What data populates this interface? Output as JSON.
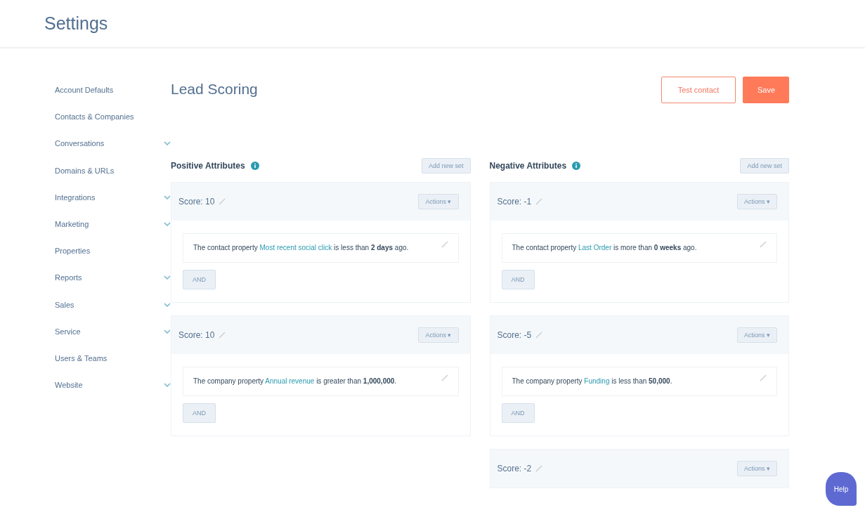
{
  "page_title": "Settings",
  "sidebar": {
    "items": [
      {
        "label": "Account Defaults",
        "expandable": false
      },
      {
        "label": "Contacts & Companies",
        "expandable": false
      },
      {
        "label": "Conversations",
        "expandable": true
      },
      {
        "label": "Domains & URLs",
        "expandable": false
      },
      {
        "label": "Integrations",
        "expandable": true
      },
      {
        "label": "Marketing",
        "expandable": true
      },
      {
        "label": "Properties",
        "expandable": false
      },
      {
        "label": "Reports",
        "expandable": true
      },
      {
        "label": "Sales",
        "expandable": true
      },
      {
        "label": "Service",
        "expandable": true
      },
      {
        "label": "Users & Teams",
        "expandable": false
      },
      {
        "label": "Website",
        "expandable": true
      }
    ]
  },
  "heading": "Lead Scoring",
  "buttons": [
    {
      "label": "Test contact",
      "kind": "secondary"
    },
    {
      "label": "Save",
      "kind": "primary"
    }
  ],
  "columns": [
    {
      "title": "Positive Attributes",
      "add_button": "Add new set",
      "sets": [
        {
          "score": "Score: 10",
          "actions": "Actions ▾",
          "rules": [
            {
              "prefix": "The contact property",
              "property": "Most recent social click",
              "suffix": "is less than **2 days** ago."
            }
          ],
          "and_button": "AND"
        },
        {
          "score": "Score: 10",
          "actions": "Actions ▾",
          "rules": [
            {
              "prefix": "The company property",
              "property": "Annual revenue",
              "suffix": "is greater than **1,000,000**."
            }
          ],
          "and_button": "AND"
        }
      ]
    },
    {
      "title": "Negative Attributes",
      "add_button": "Add new set",
      "sets": [
        {
          "score": "Score: -1",
          "actions": "Actions ▾",
          "rules": [
            {
              "prefix": "The contact property",
              "property": "Last Order",
              "suffix": "is more than **0 weeks** ago."
            }
          ],
          "and_button": "AND"
        },
        {
          "score": "Score: -5",
          "actions": "Actions ▾",
          "rules": [
            {
              "prefix": "The company property",
              "property": "Funding",
              "suffix": "is less than **50,000**."
            }
          ],
          "and_button": "AND"
        },
        {
          "score": "Score: -2",
          "actions": "Actions ▾"
        }
      ]
    }
  ],
  "help_button": "Help"
}
